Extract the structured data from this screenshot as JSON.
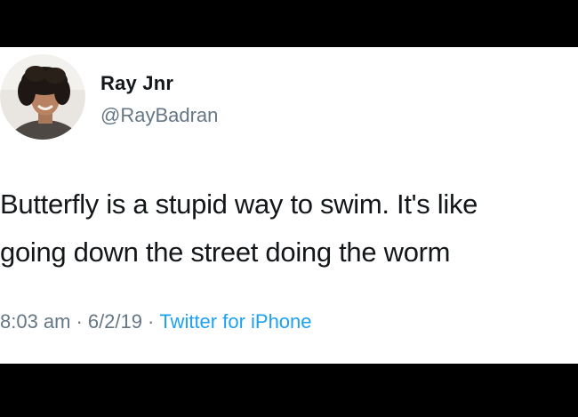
{
  "author": {
    "display_name": "Ray Jnr",
    "handle": "@RayBadran"
  },
  "tweet": {
    "text_line_1": "Butterfly is a stupid way to swim. It's like",
    "text_line_2": "going down the street doing the worm",
    "time": "8:03 am",
    "date": "6/2/19",
    "source": "Twitter for iPhone",
    "separator": "·"
  },
  "colors": {
    "background": "#000000",
    "card": "#ffffff",
    "text": "#14171a",
    "muted": "#657786",
    "link": "#1da1f2"
  }
}
